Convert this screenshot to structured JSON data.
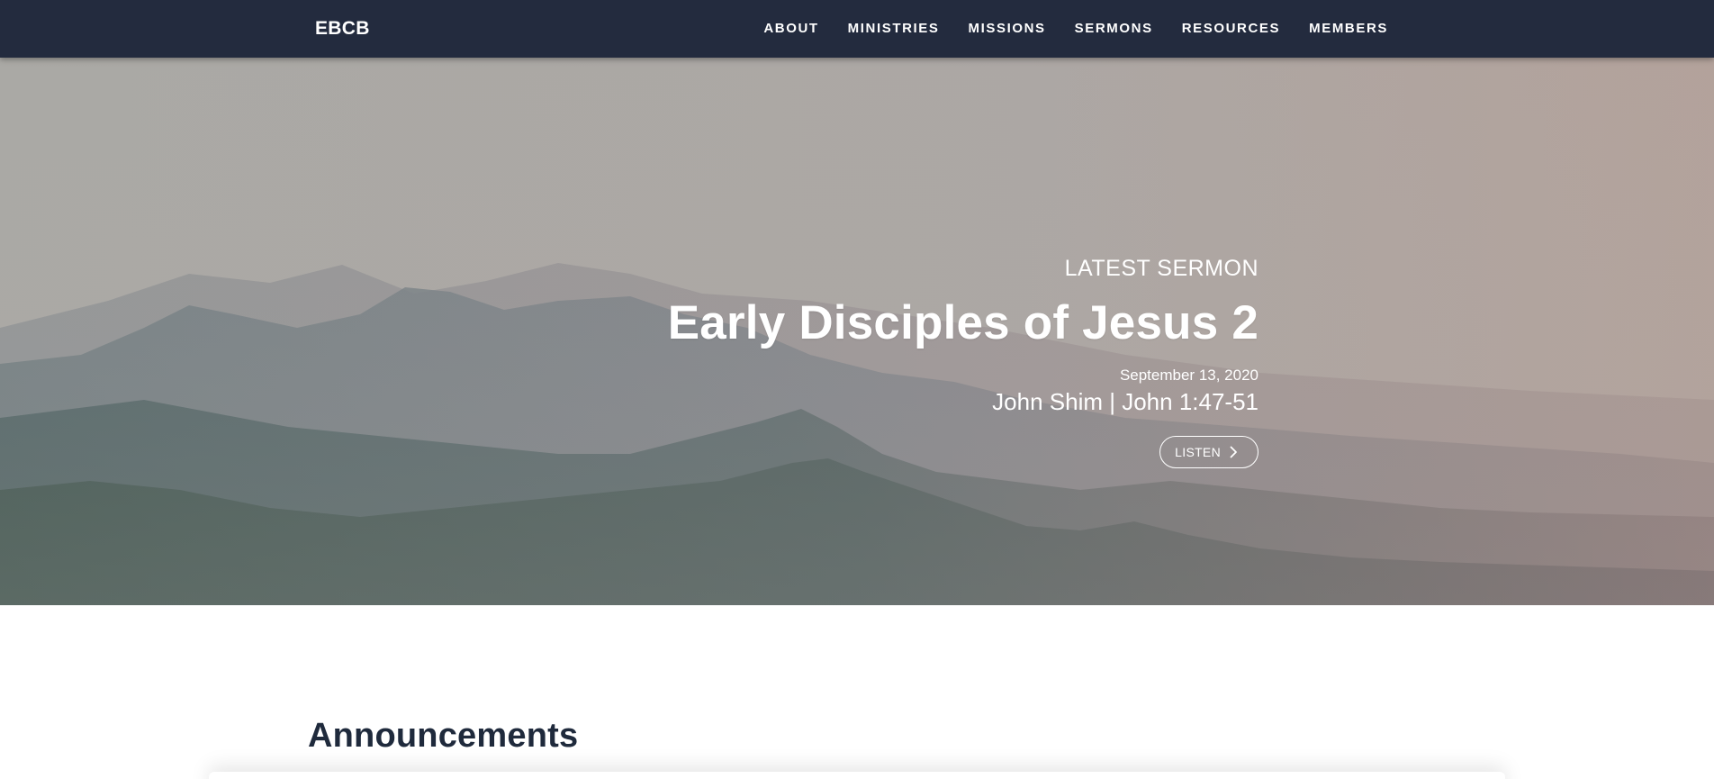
{
  "nav": {
    "brand": "EBCB",
    "links": [
      "ABOUT",
      "MINISTRIES",
      "MISSIONS",
      "SERMONS",
      "RESOURCES",
      "MEMBERS"
    ]
  },
  "hero": {
    "kicker": "LATEST SERMON",
    "title": "Early Disciples of Jesus 2",
    "date": "September 13, 2020",
    "meta": "John Shim | John 1:47-51",
    "listen_label": "LISTEN",
    "listen_icon": "chevron-right-icon"
  },
  "announcements": {
    "heading": "Announcements"
  },
  "colors": {
    "navbar_bg": "#232b3e",
    "heading_text": "#1f2a3c",
    "hero_text": "#ffffff"
  }
}
